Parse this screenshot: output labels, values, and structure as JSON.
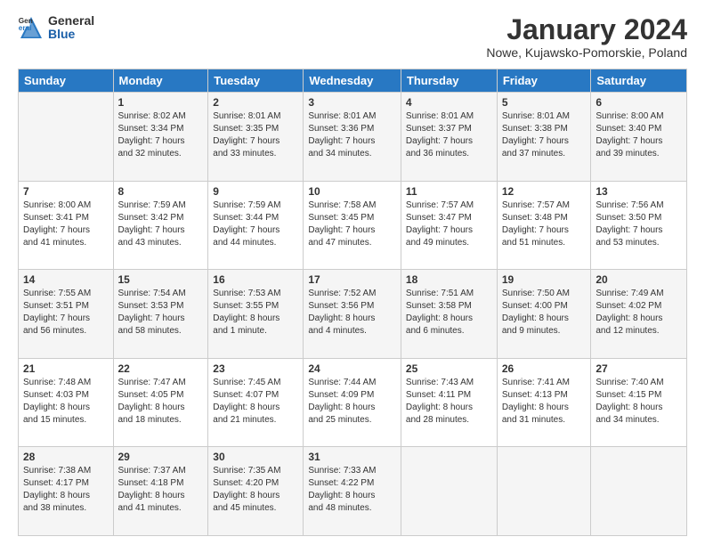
{
  "logo": {
    "general": "General",
    "blue": "Blue"
  },
  "title": "January 2024",
  "location": "Nowe, Kujawsko-Pomorskie, Poland",
  "days_of_week": [
    "Sunday",
    "Monday",
    "Tuesday",
    "Wednesday",
    "Thursday",
    "Friday",
    "Saturday"
  ],
  "weeks": [
    [
      {
        "day": "",
        "info": ""
      },
      {
        "day": "1",
        "info": "Sunrise: 8:02 AM\nSunset: 3:34 PM\nDaylight: 7 hours\nand 32 minutes."
      },
      {
        "day": "2",
        "info": "Sunrise: 8:01 AM\nSunset: 3:35 PM\nDaylight: 7 hours\nand 33 minutes."
      },
      {
        "day": "3",
        "info": "Sunrise: 8:01 AM\nSunset: 3:36 PM\nDaylight: 7 hours\nand 34 minutes."
      },
      {
        "day": "4",
        "info": "Sunrise: 8:01 AM\nSunset: 3:37 PM\nDaylight: 7 hours\nand 36 minutes."
      },
      {
        "day": "5",
        "info": "Sunrise: 8:01 AM\nSunset: 3:38 PM\nDaylight: 7 hours\nand 37 minutes."
      },
      {
        "day": "6",
        "info": "Sunrise: 8:00 AM\nSunset: 3:40 PM\nDaylight: 7 hours\nand 39 minutes."
      }
    ],
    [
      {
        "day": "7",
        "info": "Sunrise: 8:00 AM\nSunset: 3:41 PM\nDaylight: 7 hours\nand 41 minutes."
      },
      {
        "day": "8",
        "info": "Sunrise: 7:59 AM\nSunset: 3:42 PM\nDaylight: 7 hours\nand 43 minutes."
      },
      {
        "day": "9",
        "info": "Sunrise: 7:59 AM\nSunset: 3:44 PM\nDaylight: 7 hours\nand 44 minutes."
      },
      {
        "day": "10",
        "info": "Sunrise: 7:58 AM\nSunset: 3:45 PM\nDaylight: 7 hours\nand 47 minutes."
      },
      {
        "day": "11",
        "info": "Sunrise: 7:57 AM\nSunset: 3:47 PM\nDaylight: 7 hours\nand 49 minutes."
      },
      {
        "day": "12",
        "info": "Sunrise: 7:57 AM\nSunset: 3:48 PM\nDaylight: 7 hours\nand 51 minutes."
      },
      {
        "day": "13",
        "info": "Sunrise: 7:56 AM\nSunset: 3:50 PM\nDaylight: 7 hours\nand 53 minutes."
      }
    ],
    [
      {
        "day": "14",
        "info": "Sunrise: 7:55 AM\nSunset: 3:51 PM\nDaylight: 7 hours\nand 56 minutes."
      },
      {
        "day": "15",
        "info": "Sunrise: 7:54 AM\nSunset: 3:53 PM\nDaylight: 7 hours\nand 58 minutes."
      },
      {
        "day": "16",
        "info": "Sunrise: 7:53 AM\nSunset: 3:55 PM\nDaylight: 8 hours\nand 1 minute."
      },
      {
        "day": "17",
        "info": "Sunrise: 7:52 AM\nSunset: 3:56 PM\nDaylight: 8 hours\nand 4 minutes."
      },
      {
        "day": "18",
        "info": "Sunrise: 7:51 AM\nSunset: 3:58 PM\nDaylight: 8 hours\nand 6 minutes."
      },
      {
        "day": "19",
        "info": "Sunrise: 7:50 AM\nSunset: 4:00 PM\nDaylight: 8 hours\nand 9 minutes."
      },
      {
        "day": "20",
        "info": "Sunrise: 7:49 AM\nSunset: 4:02 PM\nDaylight: 8 hours\nand 12 minutes."
      }
    ],
    [
      {
        "day": "21",
        "info": "Sunrise: 7:48 AM\nSunset: 4:03 PM\nDaylight: 8 hours\nand 15 minutes."
      },
      {
        "day": "22",
        "info": "Sunrise: 7:47 AM\nSunset: 4:05 PM\nDaylight: 8 hours\nand 18 minutes."
      },
      {
        "day": "23",
        "info": "Sunrise: 7:45 AM\nSunset: 4:07 PM\nDaylight: 8 hours\nand 21 minutes."
      },
      {
        "day": "24",
        "info": "Sunrise: 7:44 AM\nSunset: 4:09 PM\nDaylight: 8 hours\nand 25 minutes."
      },
      {
        "day": "25",
        "info": "Sunrise: 7:43 AM\nSunset: 4:11 PM\nDaylight: 8 hours\nand 28 minutes."
      },
      {
        "day": "26",
        "info": "Sunrise: 7:41 AM\nSunset: 4:13 PM\nDaylight: 8 hours\nand 31 minutes."
      },
      {
        "day": "27",
        "info": "Sunrise: 7:40 AM\nSunset: 4:15 PM\nDaylight: 8 hours\nand 34 minutes."
      }
    ],
    [
      {
        "day": "28",
        "info": "Sunrise: 7:38 AM\nSunset: 4:17 PM\nDaylight: 8 hours\nand 38 minutes."
      },
      {
        "day": "29",
        "info": "Sunrise: 7:37 AM\nSunset: 4:18 PM\nDaylight: 8 hours\nand 41 minutes."
      },
      {
        "day": "30",
        "info": "Sunrise: 7:35 AM\nSunset: 4:20 PM\nDaylight: 8 hours\nand 45 minutes."
      },
      {
        "day": "31",
        "info": "Sunrise: 7:33 AM\nSunset: 4:22 PM\nDaylight: 8 hours\nand 48 minutes."
      },
      {
        "day": "",
        "info": ""
      },
      {
        "day": "",
        "info": ""
      },
      {
        "day": "",
        "info": ""
      }
    ]
  ]
}
